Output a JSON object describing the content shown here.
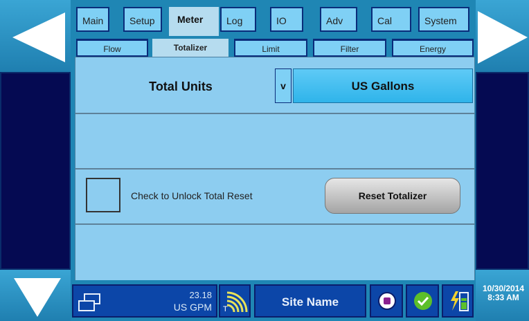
{
  "tabs": [
    {
      "label": "Main",
      "active": false
    },
    {
      "label": "Setup",
      "active": false
    },
    {
      "label": "Meter",
      "active": true
    },
    {
      "label": "Log",
      "active": false
    },
    {
      "label": "IO",
      "active": false
    },
    {
      "label": "Adv",
      "active": false
    },
    {
      "label": "Cal",
      "active": false
    },
    {
      "label": "System",
      "active": false
    }
  ],
  "subtabs": [
    {
      "label": "Flow",
      "active": false
    },
    {
      "label": "Totalizer",
      "active": true
    },
    {
      "label": "Limit",
      "active": false
    },
    {
      "label": "Filter",
      "active": false
    },
    {
      "label": "Energy",
      "active": false
    }
  ],
  "main": {
    "total_units_label": "Total Units",
    "units_dropdown": {
      "chevron": "v",
      "value": "US Gallons"
    },
    "unlock_checkbox": {
      "checked": false,
      "label": "Check to Unlock Total Reset"
    },
    "reset_button_label": "Reset Totalizer"
  },
  "status_bar": {
    "flow_value": "23.18",
    "flow_unit": "US GPM",
    "signal_tag": "T",
    "site_name": "Site Name",
    "date": "10/30/2014",
    "time": "8:33 AM"
  },
  "icons": {
    "prev": "left-arrow-icon",
    "next": "right-arrow-icon",
    "down": "down-arrow-icon",
    "display": "display-mode-icon",
    "signal": "signal-strength-icon",
    "stop": "stop-record-icon",
    "ok": "status-ok-icon",
    "battery": "battery-charging-icon"
  },
  "colors": {
    "accent": "#1f86b4",
    "tab_fill": "#7fd0f5",
    "panel": "#8dcdf0",
    "status_bar": "#0c46a8",
    "side_dark": "#050a52"
  }
}
